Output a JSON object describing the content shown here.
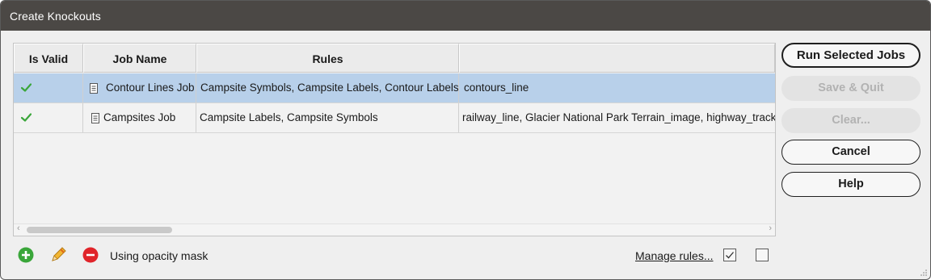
{
  "window": {
    "title": "Create Knockouts"
  },
  "table": {
    "headers": [
      "Is Valid",
      "Job Name",
      "Rules",
      ""
    ],
    "rows": [
      {
        "valid": true,
        "job_name": "Contour Lines Job",
        "rules": "Campsite Symbols, Campsite Labels, Contour Labels",
        "layers": "contours_line",
        "selected": true
      },
      {
        "valid": true,
        "job_name": "Campsites Job",
        "rules": "Campsite Labels, Campsite Symbols",
        "layers": "railway_line, Glacier National Park Terrain_image, highway_track",
        "selected": false
      }
    ]
  },
  "buttons": {
    "run": "Run Selected Jobs",
    "save_quit": "Save & Quit",
    "clear": "Clear...",
    "cancel": "Cancel",
    "help": "Help"
  },
  "footer": {
    "opacity_label": "Using opacity mask",
    "manage_rules": "Manage rules...",
    "checkbox1_checked": true,
    "checkbox2_checked": false
  },
  "colors": {
    "titlebar": "#4b4845",
    "selection": "#b8d0ea",
    "valid_check": "#3aa63a",
    "add": "#3aa63a",
    "remove": "#e0242a",
    "edit": "#e8a21c"
  },
  "icons": {
    "valid": "checkmark-icon",
    "job": "document-icon",
    "add": "add-icon",
    "edit": "pencil-icon",
    "remove": "remove-icon"
  }
}
